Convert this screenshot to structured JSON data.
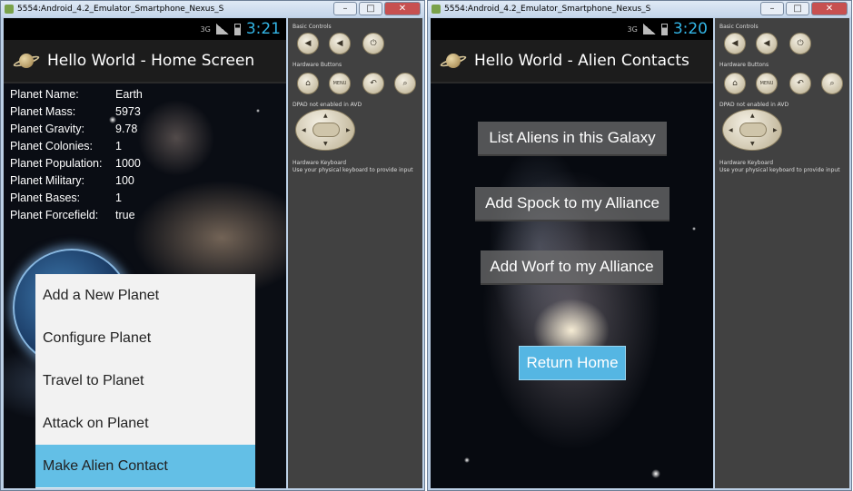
{
  "left": {
    "window_title": "5554:Android_4.2_Emulator_Smartphone_Nexus_S",
    "status": {
      "signal": "3G",
      "clock": "3:21"
    },
    "app_title": "Hello World - Home Screen",
    "stats": [
      {
        "label": "Planet Name:",
        "value": "Earth"
      },
      {
        "label": "Planet Mass:",
        "value": "5973"
      },
      {
        "label": "Planet Gravity:",
        "value": "9.78"
      },
      {
        "label": "Planet Colonies:",
        "value": "1"
      },
      {
        "label": "Planet Population:",
        "value": "1000"
      },
      {
        "label": "Planet Military:",
        "value": "100"
      },
      {
        "label": "Planet Bases:",
        "value": "1"
      },
      {
        "label": "Planet Forcefield:",
        "value": "true"
      }
    ],
    "menu": [
      "Add a New Planet",
      "Configure Planet",
      "Travel to Planet",
      "Attack on Planet",
      "Make Alien Contact"
    ],
    "menu_active_index": 4
  },
  "right": {
    "window_title": "5554:Android_4.2_Emulator_Smartphone_Nexus_S",
    "status": {
      "signal": "3G",
      "clock": "3:20"
    },
    "app_title": "Hello World - Alien Contacts",
    "buttons": [
      "List Aliens in this Galaxy",
      "Add Spock to my Alliance",
      "Add Worf to my Alliance"
    ],
    "return_button": "Return Home"
  },
  "controls_panel": {
    "basic_controls": "Basic Controls",
    "hardware_buttons": "Hardware Buttons",
    "menu_key": "MENU",
    "dpad_note": "DPAD not enabled in AVD",
    "keyboard_title": "Hardware Keyboard",
    "keyboard_note": "Use your physical keyboard to provide input"
  },
  "colors": {
    "clock": "#33b5e5",
    "menu_active": "#63bfe6",
    "return_button": "#55b6e3"
  }
}
